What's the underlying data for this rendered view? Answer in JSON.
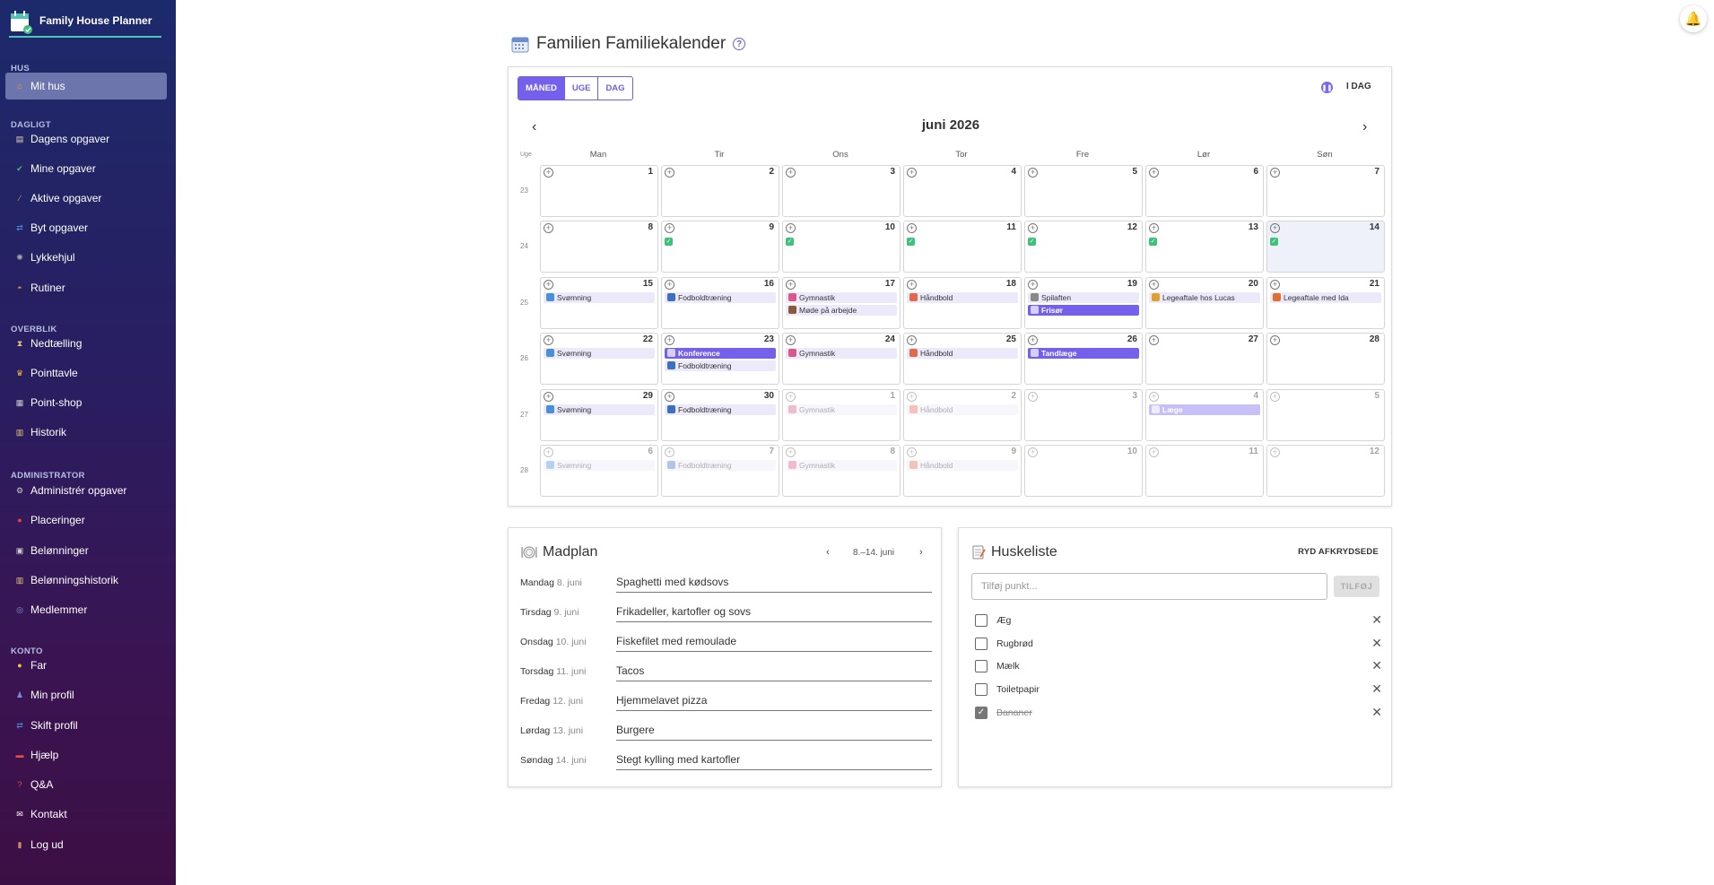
{
  "app": {
    "name": "Family House Planner"
  },
  "sidebar": {
    "sections": [
      {
        "label": "HUS",
        "items": [
          {
            "label": "Mit hus",
            "icon": "house-icon",
            "active": true
          }
        ]
      },
      {
        "label": "DAGLIGT",
        "items": [
          {
            "label": "Dagens opgaver",
            "icon": "clipboard-icon"
          },
          {
            "label": "Mine opgaver",
            "icon": "check-icon"
          },
          {
            "label": "Aktive opgaver",
            "icon": "broom-icon"
          },
          {
            "label": "Byt opgaver",
            "icon": "swap-icon"
          },
          {
            "label": "Lykkehjul",
            "icon": "wheel-icon"
          },
          {
            "label": "Rutiner",
            "icon": "sunrise-icon"
          }
        ]
      },
      {
        "label": "OVERBLIK",
        "items": [
          {
            "label": "Nedtælling",
            "icon": "hourglass-icon"
          },
          {
            "label": "Pointtavle",
            "icon": "trophy-icon"
          },
          {
            "label": "Point-shop",
            "icon": "shop-icon"
          },
          {
            "label": "Historik",
            "icon": "scroll-icon"
          }
        ]
      },
      {
        "label": "ADMINISTRATOR",
        "items": [
          {
            "label": "Administrér opgaver",
            "icon": "gear-icon"
          },
          {
            "label": "Placeringer",
            "icon": "pin-icon"
          },
          {
            "label": "Belønninger",
            "icon": "gift-icon"
          },
          {
            "label": "Belønningshistorik",
            "icon": "scroll-icon"
          },
          {
            "label": "Medlemmer",
            "icon": "people-icon"
          }
        ]
      },
      {
        "label": "KONTO",
        "items": [
          {
            "label": "Far",
            "icon": "face-icon"
          },
          {
            "label": "Min profil",
            "icon": "person-icon"
          },
          {
            "label": "Skift profil",
            "icon": "swap-icon"
          },
          {
            "label": "Hjælp",
            "icon": "sos-icon"
          },
          {
            "label": "Q&A",
            "icon": "question-icon"
          },
          {
            "label": "Kontakt",
            "icon": "mail-icon"
          },
          {
            "label": "Log ud",
            "icon": "door-icon"
          }
        ]
      }
    ]
  },
  "page": {
    "title": "Familien Familiekalender"
  },
  "calendar": {
    "views": [
      "MÅNED",
      "UGE",
      "DAG"
    ],
    "active_view": "MÅNED",
    "today_label": "I DAG",
    "month_title": "juni 2026",
    "week_label": "Uge",
    "weekdays": [
      "Man",
      "Tir",
      "Ons",
      "Tor",
      "Fre",
      "Lør",
      "Søn"
    ],
    "colors": {
      "accent": "#7560ec",
      "event_light": "#ebe9fa",
      "done": "#3cc27a"
    },
    "weeks": [
      {
        "num": "23",
        "days": [
          {
            "d": "1"
          },
          {
            "d": "2"
          },
          {
            "d": "3"
          },
          {
            "d": "4"
          },
          {
            "d": "5"
          },
          {
            "d": "6"
          },
          {
            "d": "7"
          }
        ]
      },
      {
        "num": "24",
        "days": [
          {
            "d": "8"
          },
          {
            "d": "9",
            "done": true
          },
          {
            "d": "10",
            "done": true
          },
          {
            "d": "11",
            "done": true
          },
          {
            "d": "12",
            "done": true
          },
          {
            "d": "13",
            "done": true
          },
          {
            "d": "14",
            "done": true,
            "today": true
          }
        ]
      },
      {
        "num": "25",
        "days": [
          {
            "d": "15",
            "events": [
              {
                "t": "Svømning",
                "icon": "swim-icon",
                "c": "#4a90d9"
              }
            ]
          },
          {
            "d": "16",
            "events": [
              {
                "t": "Fodboldtræning",
                "icon": "football-icon",
                "c": "#3a6fc4"
              }
            ]
          },
          {
            "d": "17",
            "events": [
              {
                "t": "Gymnastik",
                "icon": "gymnastics-icon",
                "c": "#d85a8a"
              },
              {
                "t": "Møde på arbejde",
                "icon": "briefcase-icon",
                "c": "#8a5a3a"
              }
            ]
          },
          {
            "d": "18",
            "events": [
              {
                "t": "Håndbold",
                "icon": "handball-icon",
                "c": "#e06a4a"
              }
            ]
          },
          {
            "d": "19",
            "events": [
              {
                "t": "Spilaften",
                "icon": "dice-icon",
                "c": "#888888"
              },
              {
                "t": "Frisør",
                "icon": "calendar-icon",
                "dark": true
              }
            ]
          },
          {
            "d": "20",
            "events": [
              {
                "t": "Legeaftale hos Lucas",
                "icon": "hand-icon",
                "c": "#e0a030"
              }
            ]
          },
          {
            "d": "21",
            "events": [
              {
                "t": "Legeaftale med Ida",
                "icon": "hand-icon",
                "c": "#e07030"
              }
            ]
          }
        ]
      },
      {
        "num": "26",
        "days": [
          {
            "d": "22",
            "events": [
              {
                "t": "Svømning",
                "icon": "swim-icon",
                "c": "#4a90d9"
              }
            ]
          },
          {
            "d": "23",
            "events": [
              {
                "t": "Konference",
                "icon": "calendar-icon",
                "dark": true
              },
              {
                "t": "Fodboldtræning",
                "icon": "football-icon",
                "c": "#3a6fc4"
              }
            ]
          },
          {
            "d": "24",
            "events": [
              {
                "t": "Gymnastik",
                "icon": "gymnastics-icon",
                "c": "#d85a8a"
              }
            ]
          },
          {
            "d": "25",
            "events": [
              {
                "t": "Håndbold",
                "icon": "handball-icon",
                "c": "#e06a4a"
              }
            ]
          },
          {
            "d": "26",
            "events": [
              {
                "t": "Tandlæge",
                "icon": "calendar-icon",
                "dark": true
              }
            ]
          },
          {
            "d": "27"
          },
          {
            "d": "28"
          }
        ]
      },
      {
        "num": "27",
        "days": [
          {
            "d": "29",
            "events": [
              {
                "t": "Svømning",
                "icon": "swim-icon",
                "c": "#4a90d9"
              }
            ]
          },
          {
            "d": "30",
            "events": [
              {
                "t": "Fodboldtræning",
                "icon": "football-icon",
                "c": "#3a6fc4"
              }
            ]
          },
          {
            "d": "1",
            "other": true,
            "events": [
              {
                "t": "Gymnastik",
                "icon": "gymnastics-icon",
                "c": "#d85a8a"
              }
            ]
          },
          {
            "d": "2",
            "other": true,
            "events": [
              {
                "t": "Håndbold",
                "icon": "handball-icon",
                "c": "#e06a4a"
              }
            ]
          },
          {
            "d": "3",
            "other": true
          },
          {
            "d": "4",
            "other": true,
            "events": [
              {
                "t": "Læge",
                "icon": "calendar-icon",
                "dark": true
              }
            ]
          },
          {
            "d": "5",
            "other": true
          }
        ]
      },
      {
        "num": "28",
        "days": [
          {
            "d": "6",
            "other": true,
            "events": [
              {
                "t": "Svømning",
                "icon": "swim-icon",
                "c": "#4a90d9"
              }
            ]
          },
          {
            "d": "7",
            "other": true,
            "events": [
              {
                "t": "Fodboldtræning",
                "icon": "football-icon",
                "c": "#3a6fc4"
              }
            ]
          },
          {
            "d": "8",
            "other": true,
            "events": [
              {
                "t": "Gymnastik",
                "icon": "gymnastics-icon",
                "c": "#d85a8a"
              }
            ]
          },
          {
            "d": "9",
            "other": true,
            "events": [
              {
                "t": "Håndbold",
                "icon": "handball-icon",
                "c": "#e06a4a"
              }
            ]
          },
          {
            "d": "10",
            "other": true
          },
          {
            "d": "11",
            "other": true
          },
          {
            "d": "12",
            "other": true
          }
        ]
      }
    ]
  },
  "madplan": {
    "title": "Madplan",
    "week_range": "8.–14. juni",
    "meals": [
      {
        "day": "Mandag",
        "date": "8. juni",
        "meal": "Spaghetti med kødsovs"
      },
      {
        "day": "Tirsdag",
        "date": "9. juni",
        "meal": "Frikadeller, kartofler og sovs"
      },
      {
        "day": "Onsdag",
        "date": "10. juni",
        "meal": "Fiskefilet med remoulade"
      },
      {
        "day": "Torsdag",
        "date": "11. juni",
        "meal": "Tacos"
      },
      {
        "day": "Fredag",
        "date": "12. juni",
        "meal": "Hjemmelavet pizza"
      },
      {
        "day": "Lørdag",
        "date": "13. juni",
        "meal": "Burgere"
      },
      {
        "day": "Søndag",
        "date": "14. juni",
        "meal": "Stegt kylling med kartofler"
      }
    ]
  },
  "huskeliste": {
    "title": "Huskeliste",
    "clear_label": "RYD AFKRYDSEDE",
    "input_placeholder": "Tilføj punkt...",
    "add_label": "TILFØJ",
    "items": [
      {
        "label": "Æg",
        "checked": false
      },
      {
        "label": "Rugbrød",
        "checked": false
      },
      {
        "label": "Mælk",
        "checked": false
      },
      {
        "label": "Toiletpapir",
        "checked": false
      },
      {
        "label": "Bananer",
        "checked": true
      }
    ]
  }
}
